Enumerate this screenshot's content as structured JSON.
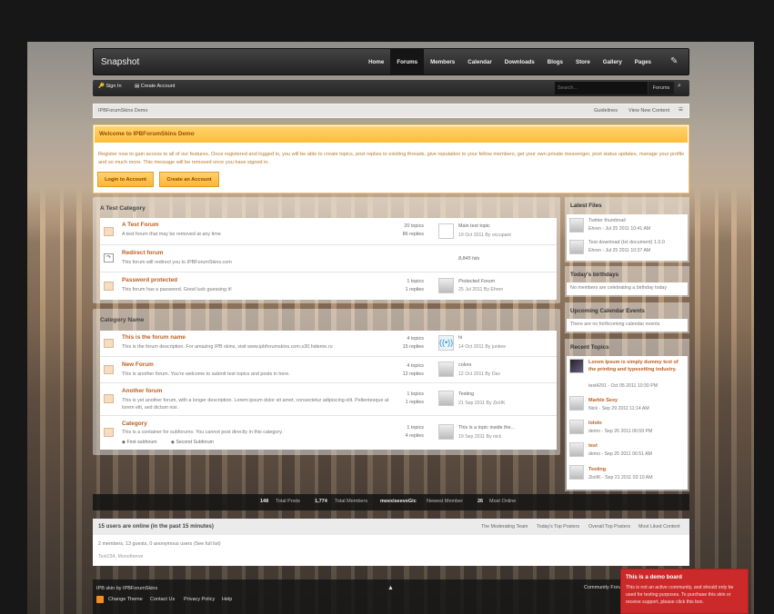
{
  "brand": {
    "logo": "Snapshot"
  },
  "nav": {
    "items": [
      "Home",
      "Forums",
      "Members",
      "Calendar",
      "Downloads",
      "Blogs",
      "Store",
      "Gallery",
      "Pages"
    ],
    "active": "Forums"
  },
  "userbar": {
    "sign_in": "Sign In",
    "create": "Create Account",
    "search_placeholder": "Search...",
    "search_scope": "Forums"
  },
  "breadcrumb": {
    "home": "IPBForumSkins Demo",
    "guidelines": "Guidelines",
    "new_content": "View New Content"
  },
  "welcome": {
    "title": "Welcome to IPBForumSkins Demo",
    "text": "Register now to gain access to all of our features. Once registered and logged in, you will be able to create topics, post replies to existing threads, give reputation to your fellow members, get your own private messenger, post status updates, manage your profile and so much more. This message will be removed once you have signed in.",
    "login": "Login to Account",
    "create": "Create an Account"
  },
  "cat1": {
    "title": "A Test Category",
    "forums": [
      {
        "name": "A Test Forum",
        "desc": "A test forum that may be removed at any time",
        "topics": "20 topics",
        "replies": "86 replies",
        "last_title": "Main test topic",
        "last_date": "19 Oct 2011 By occupant"
      },
      {
        "name": "Redirect forum",
        "desc": "This forum will redirect you to IPBForumSkins.com",
        "hits": "8,845 hits"
      },
      {
        "name": "Password protected",
        "desc": "This forum has a password. Good luck guessing it!",
        "topics": "1 topics",
        "replies": "1 replies",
        "last_title": "Protected Forum",
        "last_date": "25 Jul 2011 By Ehren"
      }
    ]
  },
  "cat2": {
    "title": "Category Name",
    "forums": [
      {
        "name": "This is the forum name",
        "desc": "This is the forum description. For amazing IPB skins, visit www.ipbforumskins.com.s30.hideme.ru",
        "topics": "4 topics",
        "replies": "15 replies",
        "last_title": "hi",
        "last_date": "14 Oct 2011 By junkee"
      },
      {
        "name": "New Forum",
        "desc": "This is another forum. You're welcome to submit test topics and posts in here.",
        "topics": "4 topics",
        "replies": "12 replies",
        "last_title": "colors",
        "last_date": "12 Oct 2011 By Dav"
      },
      {
        "name": "Another forum",
        "desc": "This is yet another forum, with a longer description. Lorem ipsum dolor sit amet, consectetur adipiscing elit. Pellentesque at lorem elit, sed dictum nisi.",
        "topics": "1 topics",
        "replies": "1 replies",
        "last_title": "Testing",
        "last_date": "21 Sep 2011 By ZioIIK"
      },
      {
        "name": "Category",
        "desc": "This is a container for subforums. You cannot post directly in this category.",
        "topics": "1 topics",
        "replies": "4 replies",
        "last_title": "This is a topic inside the...",
        "last_date": "19 Sep 2011 By nick",
        "sub1": "First subforum",
        "sub2": "Second Subforum"
      }
    ]
  },
  "latest_files": {
    "title": "Latest Files",
    "items": [
      {
        "name": "Twitter thumbnail",
        "meta": "Ehren - Jul 25 2011 10:41 AM"
      },
      {
        "name": "Test download (txt document) 1.0.0",
        "meta": "Ehren - Jul 25 2011 10:37 AM"
      }
    ]
  },
  "birthdays": {
    "title": "Today's birthdays",
    "text": "No members are celebrating a birthday today"
  },
  "events": {
    "title": "Upcoming Calendar Events",
    "text": "There are no forthcoming calendar events"
  },
  "recent": {
    "title": "Recent Topics",
    "items": [
      {
        "name": "Lorem Ipsum is simply dummy text of the printing and typesetting industry.",
        "meta": "test4291 - Oct 05 2011 10:30 PM"
      },
      {
        "name": "Marble Sexy",
        "meta": "Nick - Sep 29 2011 11:14 AM"
      },
      {
        "name": "lololo",
        "meta": "demo - Sep 26 2011 06:59 PM"
      },
      {
        "name": "test",
        "meta": "demo - Sep 25 2011 06:51 AM"
      },
      {
        "name": "Testing",
        "meta": "ZioIIK - Sep 21 2011 03:10 AM"
      }
    ]
  },
  "stats": {
    "posts_n": "148",
    "posts_l": "Total Posts",
    "members_n": "1,774",
    "members_l": "Total Members",
    "newest_n": "meexiseeveGic",
    "newest_l": "Newest Member",
    "online_n": "26",
    "online_l": "Most Online"
  },
  "online": {
    "title": "15 users are online (in the past 15 minutes)",
    "tabs": [
      "The Moderating Team",
      "Today's Top Posters",
      "Overall Top Posters",
      "Most Liked Content"
    ],
    "summary": "2 members, 13 guests, 0 anonymous users",
    "full": "(See full list)",
    "names": "Test234, Monotherve"
  },
  "footer": {
    "credit": "IPB skin by IPBForumSkins",
    "links": [
      "Change Theme",
      "Contact Us",
      "Privacy Policy",
      "Help"
    ],
    "right": "Community Forum"
  },
  "demo": {
    "title": "This is a demo board",
    "text": "This is not an active community, and should only be used for testing purposes. To purchase this skin or receive support, please click this box."
  }
}
